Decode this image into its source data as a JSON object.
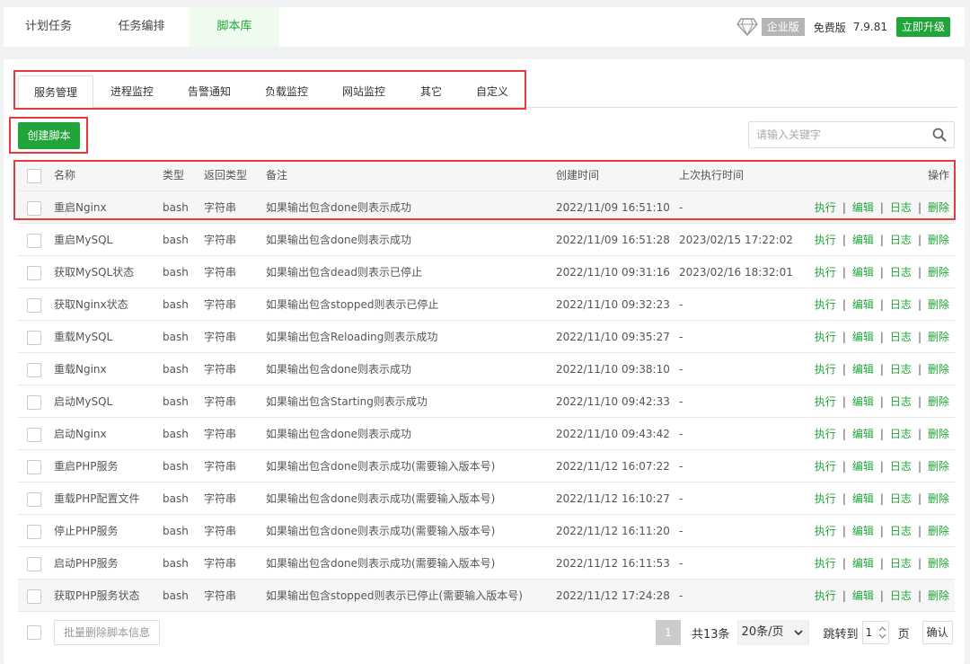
{
  "top_tabs": [
    "计划任务",
    "任务编排",
    "脚本库"
  ],
  "top_right": {
    "edition_badge": "企业版",
    "free_label": "免费版",
    "version": "7.9.81",
    "upgrade": "立即升级"
  },
  "sub_tabs": [
    "服务管理",
    "进程监控",
    "告警通知",
    "负载监控",
    "网站监控",
    "其它",
    "自定义"
  ],
  "create_button": "创建脚本",
  "search": {
    "placeholder": "请输入关键字",
    "value": ""
  },
  "table": {
    "headers": {
      "name": "名称",
      "type": "类型",
      "return_type": "返回类型",
      "note": "备注",
      "created": "创建时间",
      "last_run": "上次执行时间",
      "ops": "操作"
    },
    "ops_labels": [
      "执行",
      "编辑",
      "日志",
      "删除"
    ],
    "rows": [
      {
        "name": "重启Nginx",
        "type": "bash",
        "return_type": "字符串",
        "note": "如果输出包含done则表示成功",
        "created": "2022/11/09 16:51:10",
        "last_run": "-"
      },
      {
        "name": "重启MySQL",
        "type": "bash",
        "return_type": "字符串",
        "note": "如果输出包含done则表示成功",
        "created": "2022/11/09 16:51:28",
        "last_run": "2023/02/15 17:22:02"
      },
      {
        "name": "获取MySQL状态",
        "type": "bash",
        "return_type": "字符串",
        "note": "如果输出包含dead则表示已停止",
        "created": "2022/11/10 09:31:16",
        "last_run": "2023/02/16 18:32:01"
      },
      {
        "name": "获取Nginx状态",
        "type": "bash",
        "return_type": "字符串",
        "note": "如果输出包含stopped则表示已停止",
        "created": "2022/11/10 09:32:23",
        "last_run": "-"
      },
      {
        "name": "重载MySQL",
        "type": "bash",
        "return_type": "字符串",
        "note": "如果输出包含Reloading则表示成功",
        "created": "2022/11/10 09:35:27",
        "last_run": "-"
      },
      {
        "name": "重载Nginx",
        "type": "bash",
        "return_type": "字符串",
        "note": "如果输出包含done则表示成功",
        "created": "2022/11/10 09:38:10",
        "last_run": "-"
      },
      {
        "name": "启动MySQL",
        "type": "bash",
        "return_type": "字符串",
        "note": "如果输出包含Starting则表示成功",
        "created": "2022/11/10 09:42:33",
        "last_run": "-"
      },
      {
        "name": "启动Nginx",
        "type": "bash",
        "return_type": "字符串",
        "note": "如果输出包含done则表示成功",
        "created": "2022/11/10 09:43:42",
        "last_run": "-"
      },
      {
        "name": "重启PHP服务",
        "type": "bash",
        "return_type": "字符串",
        "note": "如果输出包含done则表示成功(需要输入版本号)",
        "created": "2022/11/12 16:07:22",
        "last_run": "-"
      },
      {
        "name": "重载PHP配置文件",
        "type": "bash",
        "return_type": "字符串",
        "note": "如果输出包含done则表示成功(需要输入版本号)",
        "created": "2022/11/12 16:10:27",
        "last_run": "-"
      },
      {
        "name": "停止PHP服务",
        "type": "bash",
        "return_type": "字符串",
        "note": "如果输出包含done则表示成功(需要输入版本号)",
        "created": "2022/11/12 16:11:20",
        "last_run": "-"
      },
      {
        "name": "启动PHP服务",
        "type": "bash",
        "return_type": "字符串",
        "note": "如果输出包含done则表示成功(需要输入版本号)",
        "created": "2022/11/12 16:11:53",
        "last_run": "-"
      },
      {
        "name": "获取PHP服务状态",
        "type": "bash",
        "return_type": "字符串",
        "note": "如果输出包含stopped则表示已停止(需要输入版本号)",
        "created": "2022/11/12 17:24:28",
        "last_run": "-"
      }
    ]
  },
  "footer": {
    "batch_delete": "批量删除脚本信息",
    "current_page": "1",
    "total": "共13条",
    "per_page": "20条/页",
    "jump_label": "跳转到",
    "jump_value": "1",
    "page_unit": "页",
    "confirm": "确认"
  },
  "colors": {
    "accent": "#20a53a",
    "highlight_border": "#e8393c"
  }
}
